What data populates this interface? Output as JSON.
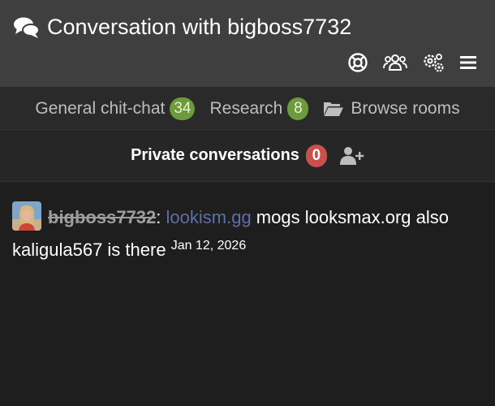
{
  "header": {
    "title": "Conversation with bigboss7732",
    "icons": [
      "help-lifebuoy-icon",
      "users-icon",
      "settings-gears-icon",
      "hamburger-menu-icon"
    ]
  },
  "tabs": [
    {
      "label": "General chit-chat",
      "count": "34"
    },
    {
      "label": "Research",
      "count": "8"
    },
    {
      "label": "Browse rooms",
      "icon": "folder-open-icon"
    }
  ],
  "private": {
    "label": "Private conversations",
    "count": "0",
    "add_icon": "add-user-icon"
  },
  "message": {
    "author": "bigboss7732",
    "separator": ":",
    "link_text": "lookism.gg",
    "text": " mogs looksmax.org also kaligula567 is there ",
    "timestamp": "Jan 12, 2026"
  },
  "colors": {
    "header_bg": "#3f3f3f",
    "page_bg": "#1e1e1e",
    "badge_green": "#6d9a3a",
    "badge_red": "#c9504b",
    "link": "#5f6fa8"
  }
}
